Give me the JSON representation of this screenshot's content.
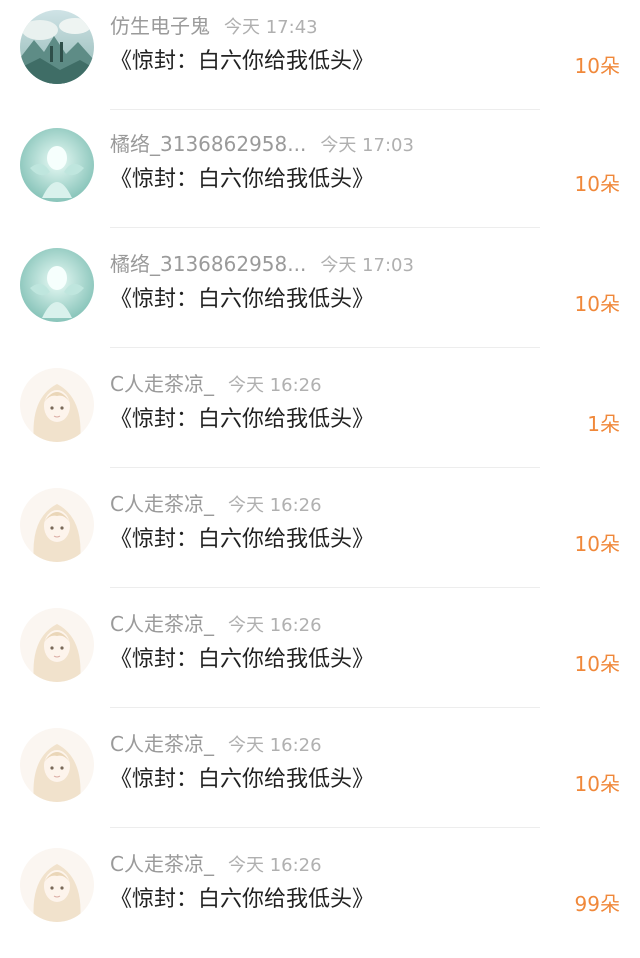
{
  "gift_records": [
    {
      "user": "仿生电子鬼",
      "time": "今天 17:43",
      "book": "《惊封：白六你给我低头》",
      "amount": "10朵",
      "avatar": "landscape"
    },
    {
      "user": "橘络_3136862958...",
      "time": "今天 17:03",
      "book": "《惊封：白六你给我低头》",
      "amount": "10朵",
      "avatar": "fairy"
    },
    {
      "user": "橘络_3136862958...",
      "time": "今天 17:03",
      "book": "《惊封：白六你给我低头》",
      "amount": "10朵",
      "avatar": "fairy"
    },
    {
      "user": "C人走茶凉_",
      "time": "今天 16:26",
      "book": "《惊封：白六你给我低头》",
      "amount": "1朵",
      "avatar": "anime-girl"
    },
    {
      "user": "C人走茶凉_",
      "time": "今天 16:26",
      "book": "《惊封：白六你给我低头》",
      "amount": "10朵",
      "avatar": "anime-girl"
    },
    {
      "user": "C人走茶凉_",
      "time": "今天 16:26",
      "book": "《惊封：白六你给我低头》",
      "amount": "10朵",
      "avatar": "anime-girl"
    },
    {
      "user": "C人走茶凉_",
      "time": "今天 16:26",
      "book": "《惊封：白六你给我低头》",
      "amount": "10朵",
      "avatar": "anime-girl"
    },
    {
      "user": "C人走茶凉_",
      "time": "今天 16:26",
      "book": "《惊封：白六你给我低头》",
      "amount": "99朵",
      "avatar": "anime-girl"
    }
  ],
  "colors": {
    "amount": "#f0883a",
    "username": "#9a9a9a",
    "title": "#222222"
  }
}
